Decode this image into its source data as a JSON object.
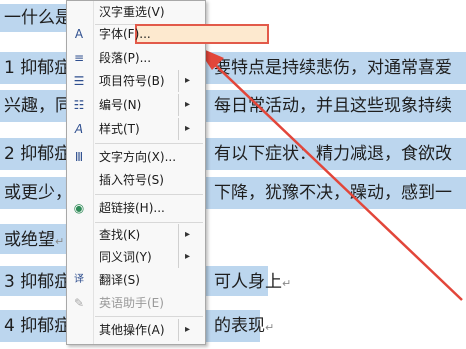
{
  "document": {
    "lines": [
      "一什么是",
      "1 抑郁症",
      "要特点是持续悲伤，对通常喜爱",
      "兴趣，同",
      "每日常活动，并且这些现象持续",
      "2 抑郁症",
      "有以下症状：精力减退，食欲改",
      "或更少，",
      "下降，犹豫不决，躁动，感到一",
      "或绝望",
      "3 抑郁症",
      "可人身上",
      "4 抑郁症",
      "的表现"
    ],
    "para_mark": "↵"
  },
  "menu": {
    "items": [
      {
        "label": "汉字重选(V)",
        "icon": "none",
        "disabled": false
      },
      {
        "label": "字体(F)...",
        "icon": "font-icon",
        "glyph": "A",
        "disabled": false
      },
      {
        "label": "段落(P)...",
        "icon": "paragraph-icon",
        "glyph": "≡",
        "disabled": false
      },
      {
        "label": "项目符号(B)",
        "icon": "bullets-icon",
        "glyph": "☰",
        "disabled": false
      },
      {
        "label": "编号(N)",
        "icon": "numbering-icon",
        "glyph": "☷",
        "disabled": false
      },
      {
        "label": "样式(T)",
        "icon": "style-icon",
        "glyph": "A",
        "disabled": false
      },
      {
        "label": "文字方向(X)...",
        "icon": "text-direction-icon",
        "glyph": "Ⅲ",
        "disabled": false
      },
      {
        "label": "插入符号(S)",
        "icon": "none",
        "disabled": false
      },
      {
        "label": "超链接(H)...",
        "icon": "hyperlink-icon",
        "glyph": "◉",
        "disabled": false
      },
      {
        "label": "查找(K)",
        "icon": "none",
        "disabled": false
      },
      {
        "label": "同义词(Y)",
        "icon": "none",
        "disabled": false
      },
      {
        "label": "翻译(S)",
        "icon": "translate-icon",
        "glyph": "译",
        "disabled": false
      },
      {
        "label": "英语助手(E)",
        "icon": "english-assistant-icon",
        "glyph": "✎",
        "disabled": true
      },
      {
        "label": "其他操作(A)",
        "icon": "none",
        "disabled": false
      }
    ],
    "submenu_arrow": "▸",
    "highlight_color": "#e25a4a"
  }
}
